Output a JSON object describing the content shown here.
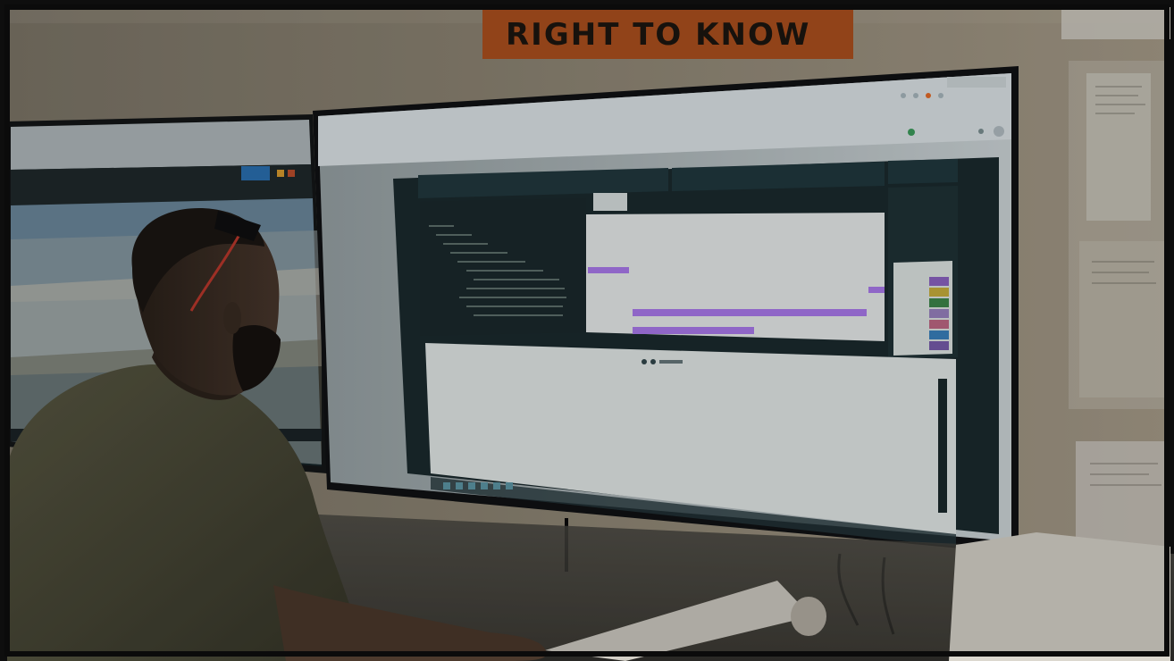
{
  "scene": {
    "sign_text": "RIGHT TO KNOW",
    "colors": {
      "wall": "#8a8372",
      "sign": "#c15a22",
      "monitor_frame": "#121416",
      "screen_panel": "#1b2b2f",
      "chart_bar": "#8f66c7",
      "shirt": "#4a4a33"
    },
    "icons": [
      "window-dots-icon",
      "taskbar-icons",
      "blueprint-roll-icon",
      "person-silhouette-icon"
    ]
  }
}
